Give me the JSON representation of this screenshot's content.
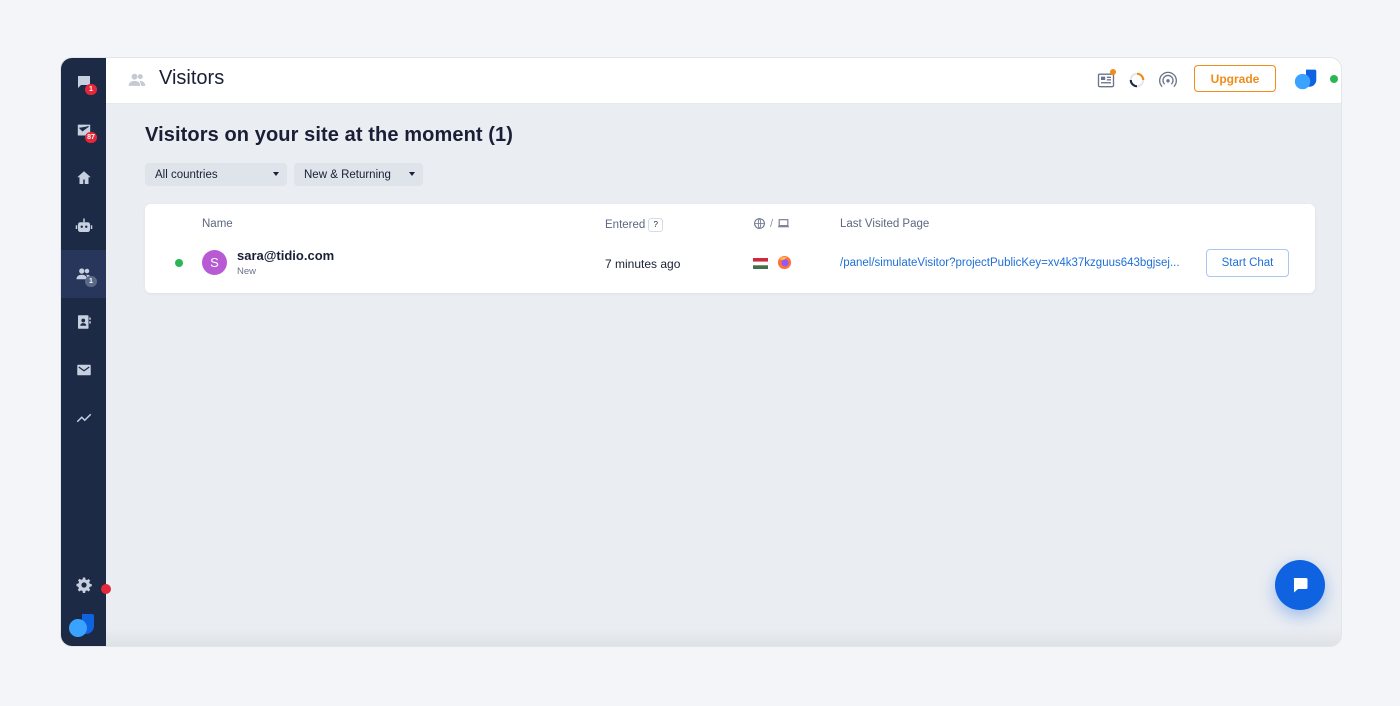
{
  "colors": {
    "sidebar_bg": "#1d2a45",
    "accent_blue": "#1f6fd6",
    "upgrade_orange": "#f08c1a",
    "online_green": "#2bb656",
    "badge_red": "#e4283a",
    "avatar_purple": "#b85ad4"
  },
  "sidebar": {
    "items": [
      {
        "icon": "chat-bubble-icon",
        "badge": "1"
      },
      {
        "icon": "inbox-icon",
        "badge": "87"
      },
      {
        "icon": "home-icon",
        "badge": ""
      },
      {
        "icon": "bot-icon",
        "badge": ""
      },
      {
        "icon": "visitors-icon",
        "badge": "1",
        "active": true
      },
      {
        "icon": "contacts-icon",
        "badge": ""
      },
      {
        "icon": "mail-icon",
        "badge": ""
      },
      {
        "icon": "analytics-icon",
        "badge": ""
      }
    ],
    "settings_icon": "gear-icon",
    "logo_icon": "tidio-logo-icon"
  },
  "header": {
    "title": "Visitors",
    "tools": [
      "news-icon",
      "loading-ring-icon",
      "broadcast-icon"
    ],
    "upgrade_label": "Upgrade"
  },
  "main": {
    "headline": "Visitors on your site at the moment (1)",
    "filters": {
      "country": "All countries",
      "visitor_type": "New & Returning"
    },
    "table": {
      "headers": {
        "name": "Name",
        "entered": "Entered",
        "help": "?",
        "separator": "/",
        "last_visited": "Last Visited Page"
      },
      "rows": [
        {
          "initial": "S",
          "name": "sara@tidio.com",
          "status": "New",
          "entered": "7 minutes ago",
          "country_flag": "hungary-flag-icon",
          "browser": "firefox-icon",
          "last_page": "/panel/simulateVisitor?projectPublicKey=xv4k37kzguus643bgjsej...",
          "action_label": "Start Chat"
        }
      ]
    }
  },
  "fab": {
    "icon": "chat-icon"
  }
}
